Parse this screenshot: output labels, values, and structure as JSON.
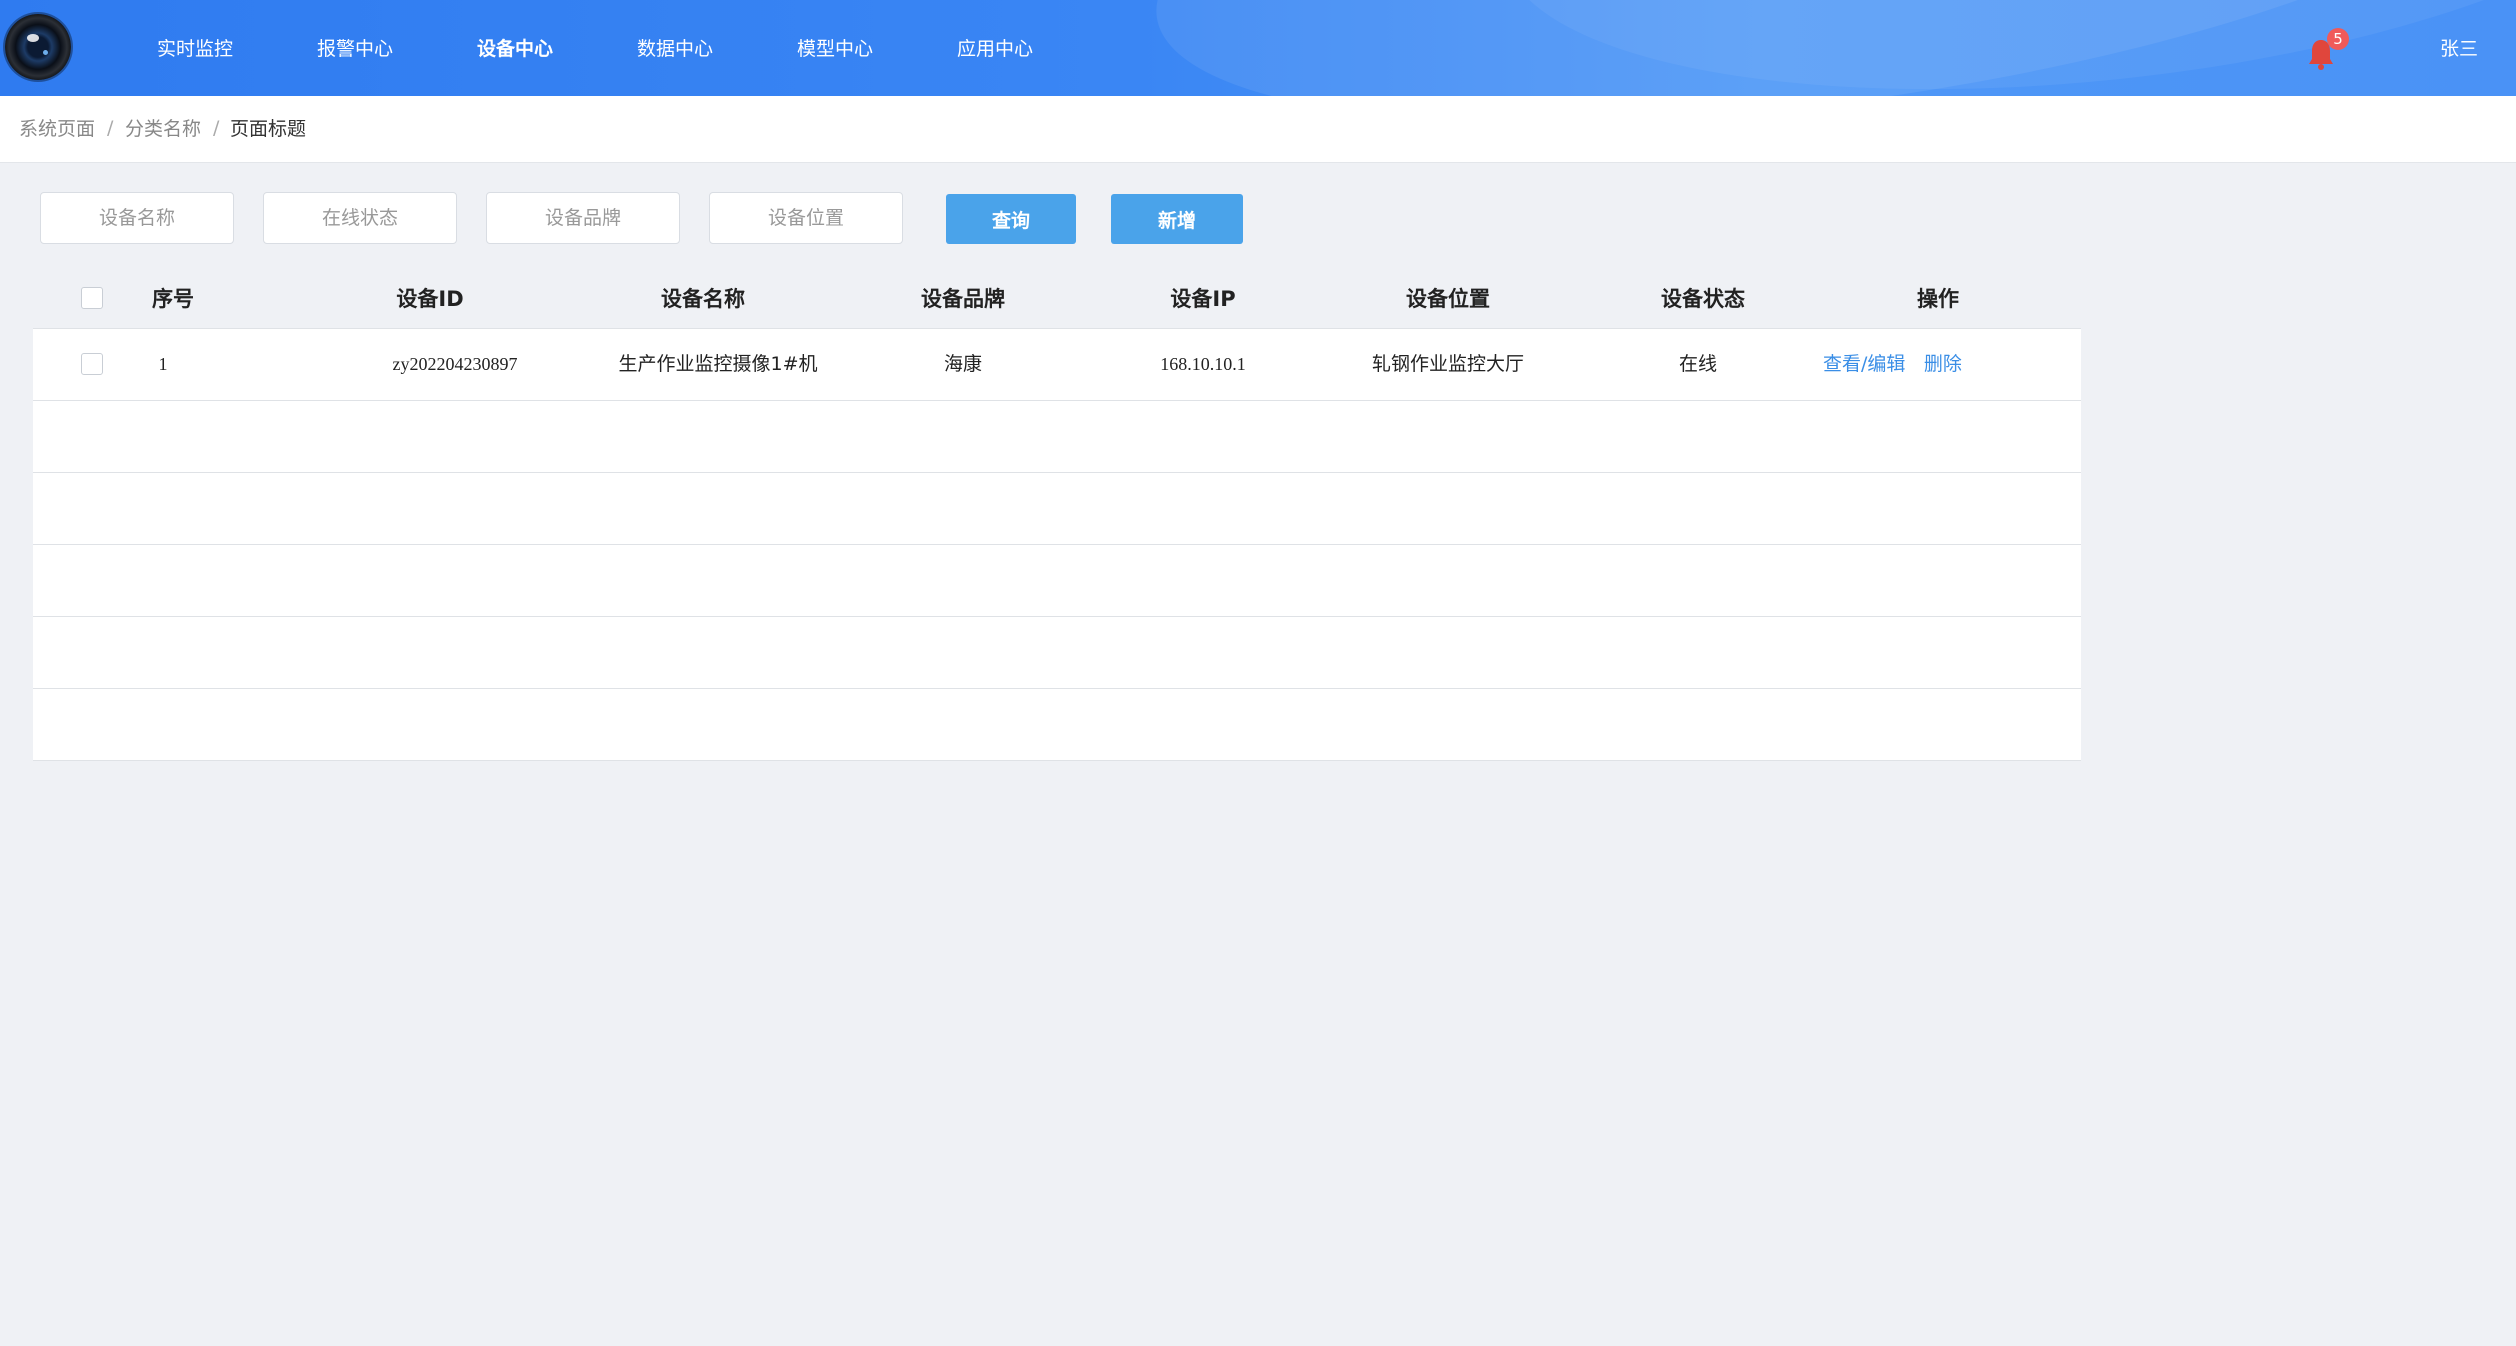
{
  "header": {
    "nav": [
      {
        "label": "实时监控",
        "active": false
      },
      {
        "label": "报警中心",
        "active": false
      },
      {
        "label": "设备中心",
        "active": true
      },
      {
        "label": "数据中心",
        "active": false
      },
      {
        "label": "模型中心",
        "active": false
      },
      {
        "label": "应用中心",
        "active": false
      }
    ],
    "notification_count": "5",
    "username": "张三",
    "colors": {
      "bar": "#3a86f4",
      "badge": "#f05a5a",
      "bell": "#e0463c"
    }
  },
  "breadcrumb": [
    "系统页面",
    "分类名称",
    "页面标题"
  ],
  "breadcrumb_separator": "/",
  "filters": {
    "device_name_placeholder": "设备名称",
    "online_status_placeholder": "在线状态",
    "device_brand_placeholder": "设备品牌",
    "device_location_placeholder": "设备位置",
    "query_label": "查询",
    "add_label": "新增"
  },
  "table": {
    "columns": [
      "序号",
      "设备ID",
      "设备名称",
      "设备品牌",
      "设备IP",
      "设备位置",
      "设备状态",
      "操作"
    ],
    "rows": [
      {
        "index": "1",
        "device_id": "zy202204230897",
        "device_name": "生产作业监控摄像1#机",
        "brand": "海康",
        "ip": "168.10.10.1",
        "location": "轧钢作业监控大厅",
        "status": "在线",
        "actions": [
          "查看/编辑",
          "删除"
        ]
      }
    ],
    "empty_rows": 5
  },
  "icons": [
    "camera-lens-logo-icon",
    "bell-icon",
    "checkbox-icon"
  ]
}
